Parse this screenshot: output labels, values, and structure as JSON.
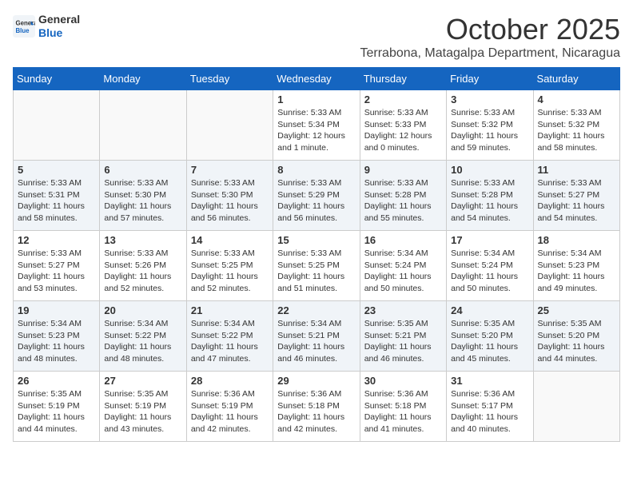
{
  "header": {
    "logo_general": "General",
    "logo_blue": "Blue",
    "month_title": "October 2025",
    "location": "Terrabona, Matagalpa Department, Nicaragua"
  },
  "days_of_week": [
    "Sunday",
    "Monday",
    "Tuesday",
    "Wednesday",
    "Thursday",
    "Friday",
    "Saturday"
  ],
  "weeks": [
    [
      {
        "day": "",
        "detail": ""
      },
      {
        "day": "",
        "detail": ""
      },
      {
        "day": "",
        "detail": ""
      },
      {
        "day": "1",
        "detail": "Sunrise: 5:33 AM\nSunset: 5:34 PM\nDaylight: 12 hours\nand 1 minute."
      },
      {
        "day": "2",
        "detail": "Sunrise: 5:33 AM\nSunset: 5:33 PM\nDaylight: 12 hours\nand 0 minutes."
      },
      {
        "day": "3",
        "detail": "Sunrise: 5:33 AM\nSunset: 5:32 PM\nDaylight: 11 hours\nand 59 minutes."
      },
      {
        "day": "4",
        "detail": "Sunrise: 5:33 AM\nSunset: 5:32 PM\nDaylight: 11 hours\nand 58 minutes."
      }
    ],
    [
      {
        "day": "5",
        "detail": "Sunrise: 5:33 AM\nSunset: 5:31 PM\nDaylight: 11 hours\nand 58 minutes."
      },
      {
        "day": "6",
        "detail": "Sunrise: 5:33 AM\nSunset: 5:30 PM\nDaylight: 11 hours\nand 57 minutes."
      },
      {
        "day": "7",
        "detail": "Sunrise: 5:33 AM\nSunset: 5:30 PM\nDaylight: 11 hours\nand 56 minutes."
      },
      {
        "day": "8",
        "detail": "Sunrise: 5:33 AM\nSunset: 5:29 PM\nDaylight: 11 hours\nand 56 minutes."
      },
      {
        "day": "9",
        "detail": "Sunrise: 5:33 AM\nSunset: 5:28 PM\nDaylight: 11 hours\nand 55 minutes."
      },
      {
        "day": "10",
        "detail": "Sunrise: 5:33 AM\nSunset: 5:28 PM\nDaylight: 11 hours\nand 54 minutes."
      },
      {
        "day": "11",
        "detail": "Sunrise: 5:33 AM\nSunset: 5:27 PM\nDaylight: 11 hours\nand 54 minutes."
      }
    ],
    [
      {
        "day": "12",
        "detail": "Sunrise: 5:33 AM\nSunset: 5:27 PM\nDaylight: 11 hours\nand 53 minutes."
      },
      {
        "day": "13",
        "detail": "Sunrise: 5:33 AM\nSunset: 5:26 PM\nDaylight: 11 hours\nand 52 minutes."
      },
      {
        "day": "14",
        "detail": "Sunrise: 5:33 AM\nSunset: 5:25 PM\nDaylight: 11 hours\nand 52 minutes."
      },
      {
        "day": "15",
        "detail": "Sunrise: 5:33 AM\nSunset: 5:25 PM\nDaylight: 11 hours\nand 51 minutes."
      },
      {
        "day": "16",
        "detail": "Sunrise: 5:34 AM\nSunset: 5:24 PM\nDaylight: 11 hours\nand 50 minutes."
      },
      {
        "day": "17",
        "detail": "Sunrise: 5:34 AM\nSunset: 5:24 PM\nDaylight: 11 hours\nand 50 minutes."
      },
      {
        "day": "18",
        "detail": "Sunrise: 5:34 AM\nSunset: 5:23 PM\nDaylight: 11 hours\nand 49 minutes."
      }
    ],
    [
      {
        "day": "19",
        "detail": "Sunrise: 5:34 AM\nSunset: 5:23 PM\nDaylight: 11 hours\nand 48 minutes."
      },
      {
        "day": "20",
        "detail": "Sunrise: 5:34 AM\nSunset: 5:22 PM\nDaylight: 11 hours\nand 48 minutes."
      },
      {
        "day": "21",
        "detail": "Sunrise: 5:34 AM\nSunset: 5:22 PM\nDaylight: 11 hours\nand 47 minutes."
      },
      {
        "day": "22",
        "detail": "Sunrise: 5:34 AM\nSunset: 5:21 PM\nDaylight: 11 hours\nand 46 minutes."
      },
      {
        "day": "23",
        "detail": "Sunrise: 5:35 AM\nSunset: 5:21 PM\nDaylight: 11 hours\nand 46 minutes."
      },
      {
        "day": "24",
        "detail": "Sunrise: 5:35 AM\nSunset: 5:20 PM\nDaylight: 11 hours\nand 45 minutes."
      },
      {
        "day": "25",
        "detail": "Sunrise: 5:35 AM\nSunset: 5:20 PM\nDaylight: 11 hours\nand 44 minutes."
      }
    ],
    [
      {
        "day": "26",
        "detail": "Sunrise: 5:35 AM\nSunset: 5:19 PM\nDaylight: 11 hours\nand 44 minutes."
      },
      {
        "day": "27",
        "detail": "Sunrise: 5:35 AM\nSunset: 5:19 PM\nDaylight: 11 hours\nand 43 minutes."
      },
      {
        "day": "28",
        "detail": "Sunrise: 5:36 AM\nSunset: 5:19 PM\nDaylight: 11 hours\nand 42 minutes."
      },
      {
        "day": "29",
        "detail": "Sunrise: 5:36 AM\nSunset: 5:18 PM\nDaylight: 11 hours\nand 42 minutes."
      },
      {
        "day": "30",
        "detail": "Sunrise: 5:36 AM\nSunset: 5:18 PM\nDaylight: 11 hours\nand 41 minutes."
      },
      {
        "day": "31",
        "detail": "Sunrise: 5:36 AM\nSunset: 5:17 PM\nDaylight: 11 hours\nand 40 minutes."
      },
      {
        "day": "",
        "detail": ""
      }
    ]
  ]
}
